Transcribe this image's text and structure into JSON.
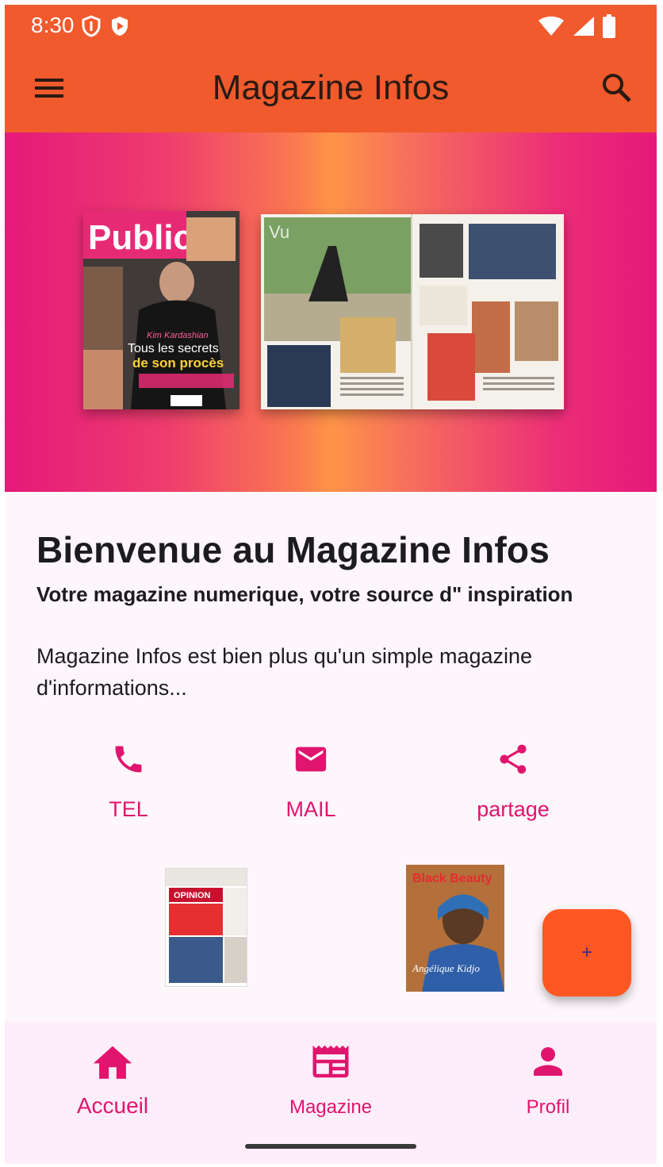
{
  "status_bar": {
    "time": "8:30",
    "left_icons": [
      "shield-icon",
      "play-protect-icon"
    ],
    "right_icons": [
      "wifi-icon",
      "signal-icon",
      "battery-icon"
    ]
  },
  "app_bar": {
    "title": "Magazine Infos",
    "menu_icon": "menu-icon",
    "search_icon": "search-icon",
    "color": "#f05a2d"
  },
  "hero": {
    "cover": {
      "masthead": "Public",
      "headline_1": "Kim Kardashian",
      "headline_2": "Tous les secrets",
      "headline_3": "de son procès"
    },
    "spread": {
      "section": "Vu"
    }
  },
  "content": {
    "title": "Bienvenue au Magazine Infos",
    "subtitle": "Votre magazine numerique, votre source d\" inspiration",
    "description": "Magazine Infos est bien plus qu'un simple magazine d'informations..."
  },
  "actions": [
    {
      "label": "TEL",
      "icon": "phone-icon"
    },
    {
      "label": "MAIL",
      "icon": "mail-icon"
    },
    {
      "label": "partage",
      "icon": "share-icon"
    }
  ],
  "thumbnails": {
    "thumb1": {
      "masthead": "OPINION"
    },
    "thumb2": {
      "masthead": "Black Beauty",
      "headline": "Angélique Kidjo"
    }
  },
  "fab": {
    "label": "+"
  },
  "bottom_nav": [
    {
      "label": "Accueil",
      "icon": "home-icon",
      "active": true
    },
    {
      "label": "Magazine",
      "icon": "newspaper-icon",
      "active": false
    },
    {
      "label": "Profil",
      "icon": "person-icon",
      "active": false
    }
  ],
  "colors": {
    "accent": "#e0156e",
    "fab": "#ff5722",
    "background": "#fdf6fb",
    "nav_background": "#fdeefa"
  }
}
